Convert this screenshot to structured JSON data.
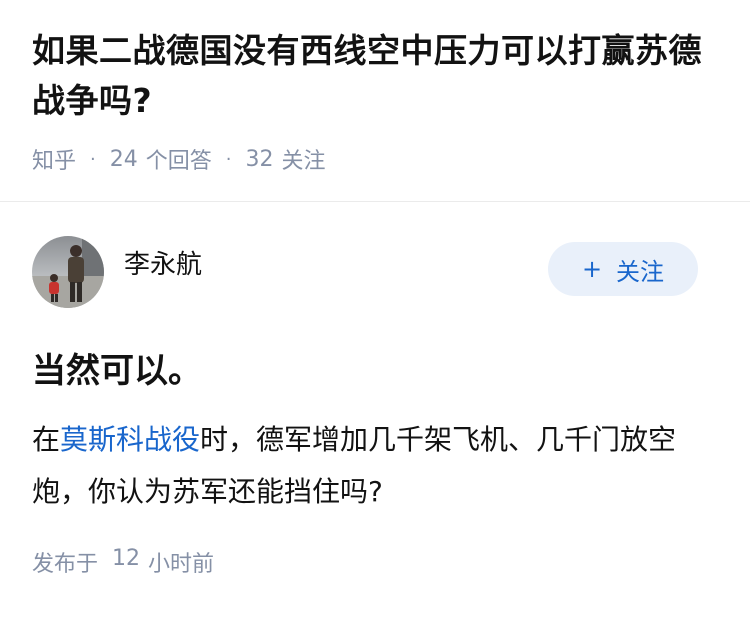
{
  "question": {
    "title": "如果二战德国没有西线空中压力可以打赢苏德战争吗?",
    "source": "知乎",
    "answers_count": "24",
    "answers_label": "个回答",
    "followers_count": "32",
    "followers_label": "关注"
  },
  "answer": {
    "author_name": "李永航",
    "follow_label": "关注",
    "heading": "当然可以。",
    "body_prefix": "在",
    "body_link": "莫斯科战役",
    "body_suffix": "时，德军增加几千架飞机、几千门放空炮，你认为苏军还能挡住吗?",
    "time_prefix": "发布于",
    "time_value": "12",
    "time_unit": "小时前"
  },
  "colors": {
    "link": "#1966cc",
    "meta": "#8590a6",
    "follow_bg": "#e9f0fa"
  }
}
